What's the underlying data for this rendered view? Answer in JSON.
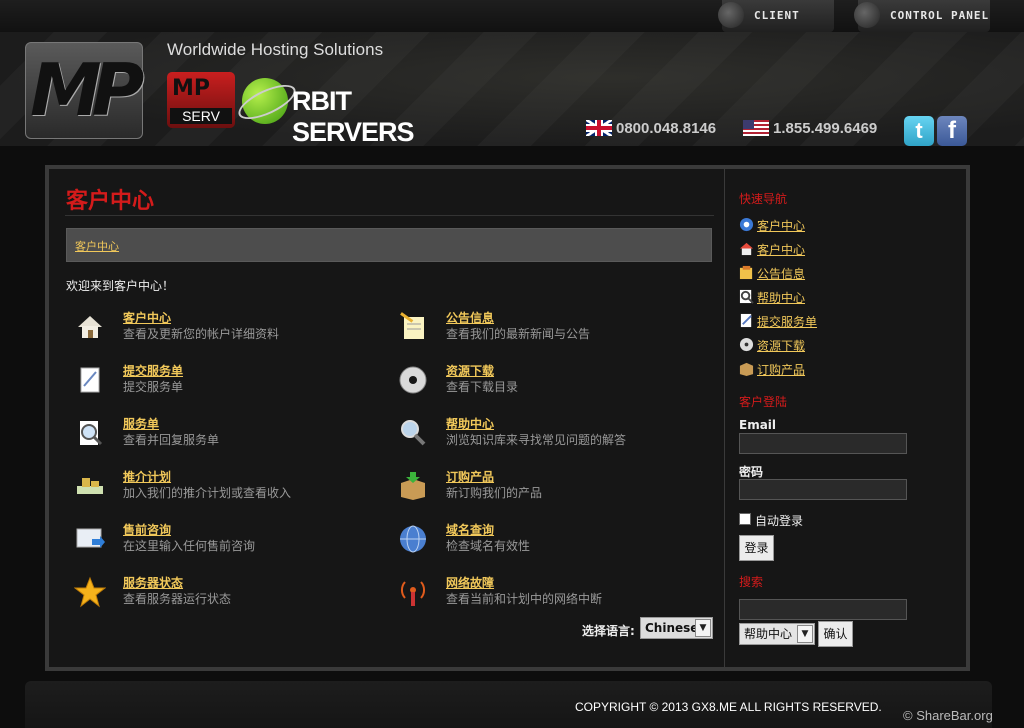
{
  "topbar": {
    "client_area": "CLIENT AREA",
    "control_panel": "CONTROL PANEL"
  },
  "header": {
    "logo_text": "MP",
    "tagline": "Worldwide Hosting Solutions",
    "mp_logo_top": "MP",
    "mp_logo_bottom": "SERV",
    "orbit_logo": "RBIT SERVERS",
    "phone_uk": "0800.048.8146",
    "phone_us": "1.855.499.6469",
    "twitter": "t",
    "facebook": "f"
  },
  "main": {
    "title": "客户中心",
    "breadcrumb": "客户中心",
    "welcome": "欢迎来到客户中心！",
    "items": [
      {
        "title": "客户中心",
        "desc": "查看及更新您的帐户详细资料",
        "icon": "home-icon"
      },
      {
        "title": "公告信息",
        "desc": "查看我们的最新新闻与公告",
        "icon": "notepad-icon"
      },
      {
        "title": "提交服务单",
        "desc": "提交服务单",
        "icon": "document-icon"
      },
      {
        "title": "资源下载",
        "desc": "查看下载目录",
        "icon": "disc-icon"
      },
      {
        "title": "服务单",
        "desc": "查看并回复服务单",
        "icon": "magnifier-icon"
      },
      {
        "title": "帮助中心",
        "desc": "浏览知识库来寻找常见问题的解答",
        "icon": "search-icon"
      },
      {
        "title": "推介计划",
        "desc": "加入我们的推介计划或查看收入",
        "icon": "money-icon"
      },
      {
        "title": "订购产品",
        "desc": "新订购我们的产品",
        "icon": "box-icon"
      },
      {
        "title": "售前咨询",
        "desc": "在这里输入任何售前咨询",
        "icon": "mail-icon"
      },
      {
        "title": "域名查询",
        "desc": "检查域名有效性",
        "icon": "globe-icon"
      },
      {
        "title": "服务器状态",
        "desc": "查看服务器运行状态",
        "icon": "star-icon"
      },
      {
        "title": "网络故障",
        "desc": "查看当前和计划中的网络中断",
        "icon": "antenna-icon"
      }
    ],
    "language_label": "选择语言:",
    "language_value": "Chinese"
  },
  "sidebar": {
    "quick_nav_title": "快速导航",
    "nav": [
      {
        "label": "客户中心",
        "icon": "globe-icon"
      },
      {
        "label": "客户中心",
        "icon": "home-icon"
      },
      {
        "label": "公告信息",
        "icon": "megaphone-icon"
      },
      {
        "label": "帮助中心",
        "icon": "magnifier-icon"
      },
      {
        "label": "提交服务单",
        "icon": "document-icon"
      },
      {
        "label": "资源下载",
        "icon": "disc-icon"
      },
      {
        "label": "订购产品",
        "icon": "box-icon"
      }
    ],
    "login_title": "客户登陆",
    "email_label": "Email",
    "email_value": "",
    "password_label": "密码",
    "password_value": "",
    "remember_label": "自动登录",
    "login_button": "登录",
    "search_title": "搜索",
    "search_value": "",
    "search_select": "帮助中心",
    "search_button": "确认"
  },
  "footer": {
    "copyright": "COPYRIGHT © 2013 GX8.ME ALL RIGHTS RESERVED.",
    "watermark": "© ShareBar.org"
  },
  "colors": {
    "accent_red": "#d41b1b",
    "link_gold": "#f1c85a",
    "background": "#0d0d0d"
  }
}
